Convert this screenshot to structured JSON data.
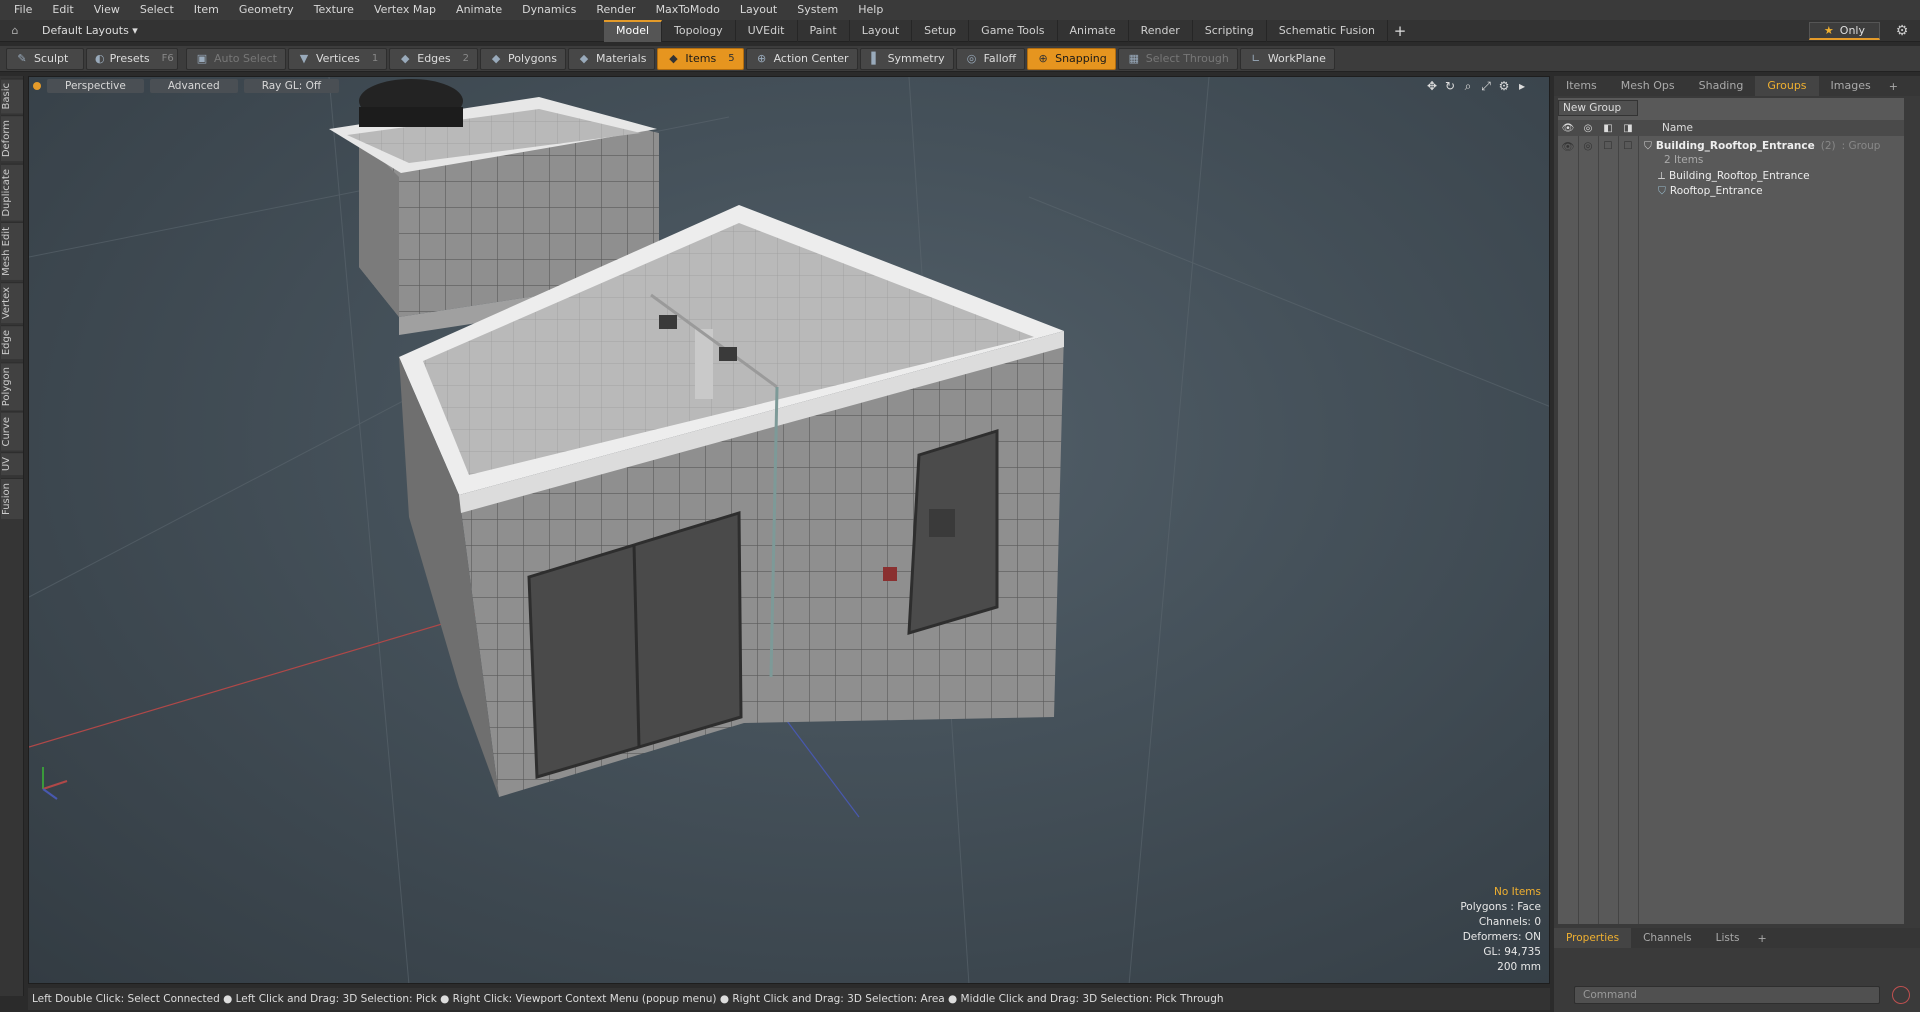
{
  "menu": [
    "File",
    "Edit",
    "View",
    "Select",
    "Item",
    "Geometry",
    "Texture",
    "Vertex Map",
    "Animate",
    "Dynamics",
    "Render",
    "MaxToModo",
    "Layout",
    "System",
    "Help"
  ],
  "layout": {
    "dropdown": "Default Layouts ▾"
  },
  "tabs": [
    "Model",
    "Topology",
    "UVEdit",
    "Paint",
    "Layout",
    "Setup",
    "Game Tools",
    "Animate",
    "Render",
    "Scripting",
    "Schematic Fusion"
  ],
  "active_tab": "Model",
  "only_label": "Only",
  "toolbar": {
    "sculpt": "Sculpt",
    "presets": "Presets",
    "presets_key": "F6",
    "auto_select": "Auto Select",
    "vertices": "Vertices",
    "vertices_count": "1",
    "edges": "Edges",
    "edges_count": "2",
    "polygons": "Polygons",
    "materials": "Materials",
    "items": "Items",
    "items_count": "5",
    "action_center": "Action Center",
    "symmetry": "Symmetry",
    "falloff": "Falloff",
    "snapping": "Snapping",
    "select_through": "Select Through",
    "workplane": "WorkPlane"
  },
  "left_tabs": [
    "Basic",
    "Deform",
    "Duplicate",
    "Mesh Edit",
    "Vertex",
    "Edge",
    "Polygon",
    "Curve",
    "UV",
    "Fusion"
  ],
  "viewport": {
    "view": "Perspective",
    "shading": "Advanced",
    "raygl": "Ray GL: Off"
  },
  "stats": {
    "selection": "No Items",
    "polygons": "Polygons : Face",
    "channels": "Channels: 0",
    "deformers": "Deformers: ON",
    "gl": "GL: 94,735",
    "scale": "200 mm"
  },
  "statusbar": "Left Double Click: Select Connected ● Left Click and Drag: 3D Selection: Pick ● Right Click: Viewport Context Menu (popup menu) ● Right Click and Drag: 3D Selection: Area ● Middle Click and Drag: 3D Selection: Pick Through",
  "right_panel": {
    "tabs": [
      "Items",
      "Mesh Ops",
      "Shading",
      "Groups",
      "Images"
    ],
    "active_tab": "Groups",
    "new_group": "New Group",
    "name_header": "Name",
    "group_name": "Building_Rooftop_Entrance",
    "group_count": "(2)",
    "group_type": ": Group",
    "group_items": "2 Items",
    "children": [
      "Building_Rooftop_Entrance",
      "Rooftop_Entrance"
    ],
    "bottom_tabs": [
      "Properties",
      "Channels",
      "Lists"
    ],
    "bottom_active": "Properties",
    "command_placeholder": "Command"
  },
  "colors": {
    "accent": "#e49b2a",
    "viewport_bg": "#45515a",
    "highlight_text": "#f0b030"
  }
}
